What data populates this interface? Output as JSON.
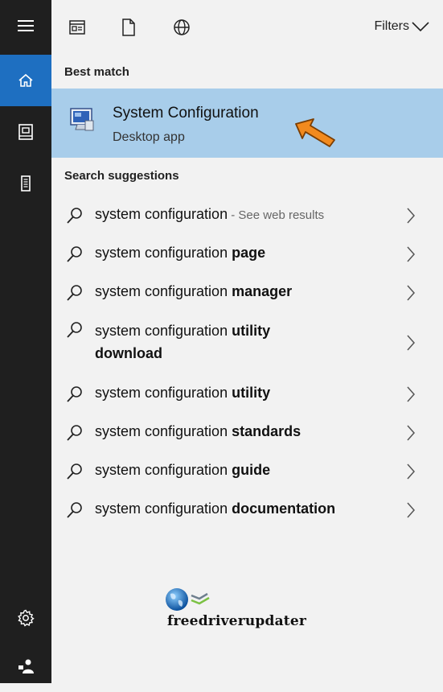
{
  "rail": {
    "items": [
      "hamburger-menu-icon",
      "home-icon",
      "documents-icon",
      "device-icon"
    ],
    "bottom": [
      "settings-icon",
      "user-icon"
    ],
    "active_color": "#1e6fc1"
  },
  "toolbar": {
    "filters_label": "Filters"
  },
  "best_match": {
    "heading": "Best match",
    "title": "System Configuration",
    "subtitle": "Desktop app",
    "highlight_color": "#a8cdea"
  },
  "suggestions": {
    "heading": "Search suggestions",
    "items": [
      {
        "prefix": "system configuration",
        "bold": "",
        "suffix": " - See web results"
      },
      {
        "prefix": "system configuration ",
        "bold": "page",
        "suffix": ""
      },
      {
        "prefix": "system configuration ",
        "bold": "manager",
        "suffix": ""
      },
      {
        "prefix": "system configuration ",
        "bold": "utility",
        "suffix": "",
        "line2": "download"
      },
      {
        "prefix": "system configuration ",
        "bold": "utility",
        "suffix": ""
      },
      {
        "prefix": "system configuration ",
        "bold": "standards",
        "suffix": ""
      },
      {
        "prefix": "system configuration ",
        "bold": "guide",
        "suffix": ""
      },
      {
        "prefix": "system configuration ",
        "bold": "documentation",
        "suffix": ""
      }
    ]
  },
  "watermark": {
    "text": "freedriverupdater"
  }
}
